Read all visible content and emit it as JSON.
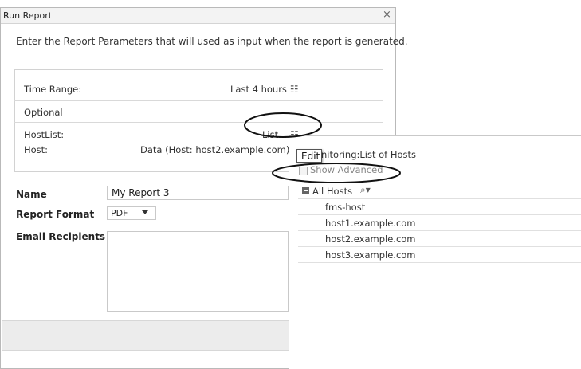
{
  "dialog": {
    "title": "Run Report",
    "close_glyph": "×",
    "intro": "Enter the Report Parameters that will used as input when the report is generated."
  },
  "params": {
    "time_range_label": "Time Range:",
    "time_range_value": "Last 4 hours",
    "optional_label": "Optional",
    "hostlist_label": "HostList:",
    "hostlist_value": "List...",
    "host_label": "Host:",
    "host_value": "Data (Host: host2.example.com)",
    "list_icon": "list-select-icon"
  },
  "form": {
    "name_label": "Name",
    "name_value": "My Report 3",
    "format_label": "Report Format",
    "format_value": "PDF",
    "email_label": "Email Recipients",
    "email_value": ""
  },
  "popup": {
    "title": "Monitoring:List of Hosts",
    "tooltip": "Edit",
    "show_advanced": "Show Advanced",
    "tree_root": "All Hosts",
    "hosts": [
      "fms-host",
      "host1.example.com",
      "host2.example.com",
      "host3.example.com"
    ]
  }
}
